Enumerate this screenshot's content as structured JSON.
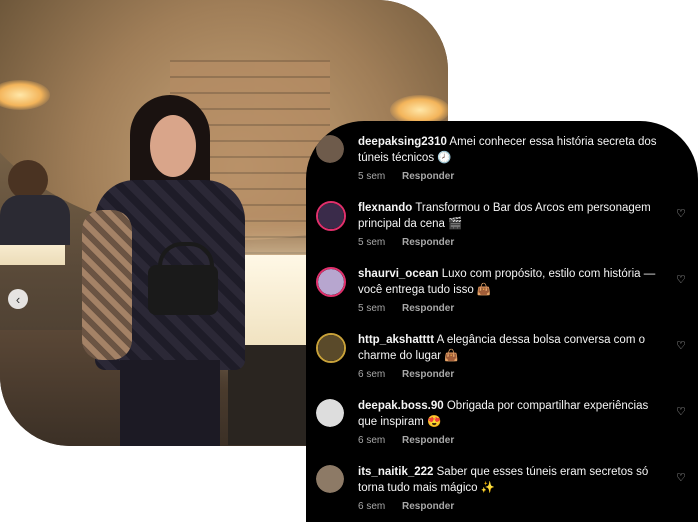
{
  "photo": {
    "nav_icon": "chevron-left-icon",
    "nav_glyph": "‹"
  },
  "comments": [
    {
      "username": "deepaksing2310",
      "text": "Amei conhecer essa história secreta dos túneis técnicos 🕗",
      "time": "5 sem",
      "reply": "Responder",
      "avatar_color": "#6e5b4b"
    },
    {
      "username": "flexnando",
      "text": "Transformou o Bar dos Arcos em personagem principal da cena 🎬",
      "time": "5 sem",
      "reply": "Responder",
      "avatar_color": "#3a2b4a"
    },
    {
      "username": "shaurvi_ocean",
      "text": "Luxo com propósito, estilo com história — você entrega tudo isso 👜",
      "time": "5 sem",
      "reply": "Responder",
      "avatar_color": "#b7a6cf"
    },
    {
      "username": "http_akshatttt",
      "text": "A elegância dessa bolsa conversa com o charme do lugar 👜",
      "time": "6 sem",
      "reply": "Responder",
      "avatar_color": "#c9a23a"
    },
    {
      "username": "deepak.boss.90",
      "text": "Obrigada por compartilhar experiências que inspiram 😍",
      "time": "6 sem",
      "reply": "Responder",
      "avatar_color": "#dddddd"
    },
    {
      "username": "its_naitik_222",
      "text": "Saber que esses túneis eram secretos só torna tudo mais mágico ✨",
      "time": "6 sem",
      "reply": "Responder",
      "avatar_color": "#8d7a66"
    }
  ],
  "heart_glyph": "♡",
  "colors": {
    "card_bg": "#000000",
    "text": "#f5f5f5",
    "meta": "#a8a8a8",
    "story_ring": "#e1306c"
  }
}
